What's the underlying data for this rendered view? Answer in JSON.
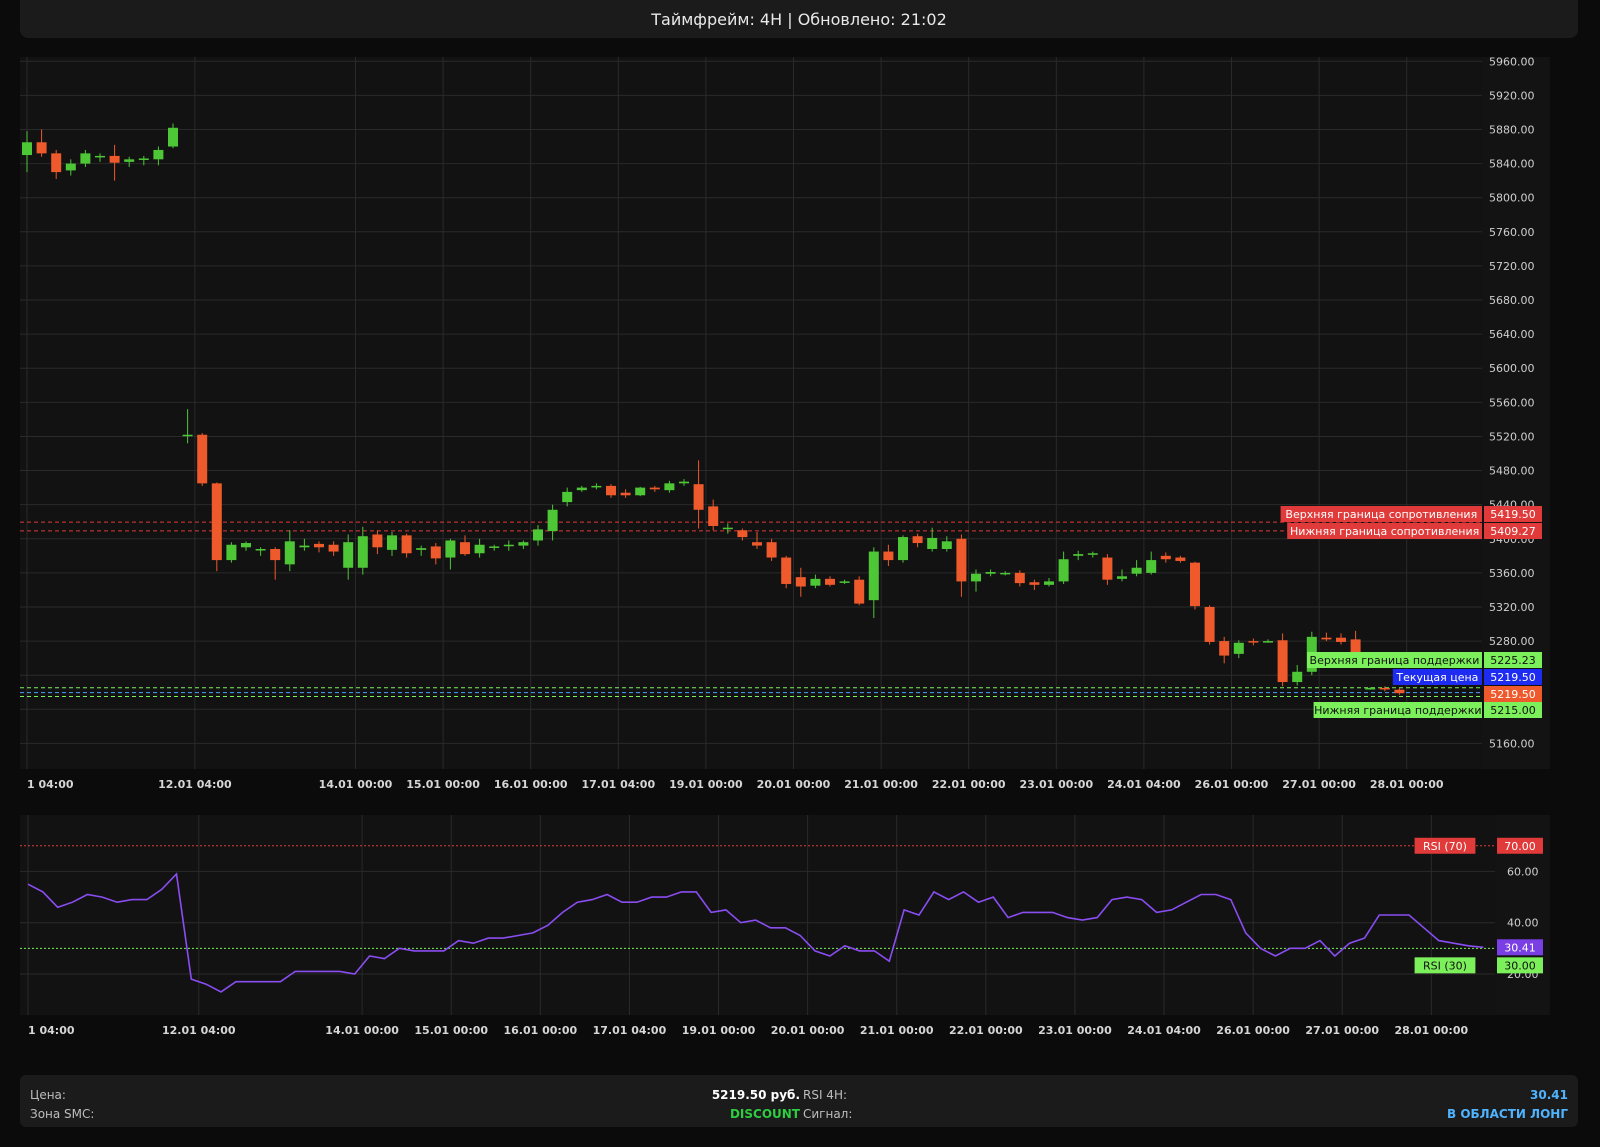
{
  "header": {
    "subtitle": "Таймфрейм: 4H | Обновлено: 21:02"
  },
  "colors": {
    "up": "#4ec737",
    "down": "#ee5a2b",
    "resistance": "#e03a3a",
    "support": "#7cf05a",
    "current": "#1d2cf0",
    "rsi_line": "#8a4df2",
    "rsi_badge": "#7a3fe4",
    "grid": "#2a2a2a"
  },
  "chart_data": [
    {
      "type": "candlestick",
      "yaxis": {
        "ticks": [
          "5960.00",
          "5920.00",
          "5880.00",
          "5840.00",
          "5800.00",
          "5760.00",
          "5720.00",
          "5680.00",
          "5640.00",
          "5600.00",
          "5560.00",
          "5520.00",
          "5480.00",
          "5440.00",
          "5400.00",
          "5360.00",
          "5320.00",
          "5280.00",
          "5240.00",
          "5200.00",
          "5160.00"
        ],
        "range": [
          5130,
          5965
        ]
      },
      "xaxis": {
        "ticks": [
          "1 04:00",
          "12.01 04:00",
          "14.01 00:00",
          "15.01 00:00",
          "16.01 00:00",
          "17.01 04:00",
          "19.01 00:00",
          "20.01 00:00",
          "21.01 00:00",
          "22.01 00:00",
          "23.01 00:00",
          "24.01 04:00",
          "26.01 00:00",
          "27.01 00:00",
          "28.01 00:00"
        ],
        "tick_index": [
          0,
          11.5,
          22.5,
          28.5,
          34.5,
          40.5,
          46.5,
          52.5,
          58.5,
          64.5,
          70.5,
          76.5,
          82.5,
          88.5,
          94.5
        ]
      },
      "candles": [
        [
          5850,
          5865,
          5878,
          5830
        ],
        [
          5865,
          5852,
          5880,
          5848
        ],
        [
          5852,
          5830,
          5856,
          5822
        ],
        [
          5832,
          5840,
          5845,
          5826
        ],
        [
          5840,
          5852,
          5856,
          5836
        ],
        [
          5848,
          5849,
          5852,
          5842
        ],
        [
          5849,
          5841,
          5862,
          5820
        ],
        [
          5842,
          5845,
          5848,
          5836
        ],
        [
          5846,
          5846,
          5849,
          5838
        ],
        [
          5845,
          5856,
          5860,
          5838
        ],
        [
          5860,
          5882,
          5887,
          5858
        ],
        [
          5522,
          5522,
          5552,
          5512
        ],
        [
          5522,
          5465,
          5524,
          5462
        ],
        [
          5465,
          5375,
          5466,
          5362
        ],
        [
          5375,
          5393,
          5396,
          5372
        ],
        [
          5390,
          5395,
          5397,
          5386
        ],
        [
          5387,
          5388,
          5390,
          5380
        ],
        [
          5388,
          5375,
          5390,
          5352
        ],
        [
          5370,
          5397,
          5410,
          5362
        ],
        [
          5390,
          5392,
          5400,
          5386
        ],
        [
          5394,
          5390,
          5397,
          5384
        ],
        [
          5393,
          5385,
          5397,
          5380
        ],
        [
          5366,
          5396,
          5405,
          5352
        ],
        [
          5366,
          5403,
          5414,
          5358
        ],
        [
          5405,
          5390,
          5410,
          5382
        ],
        [
          5387,
          5404,
          5408,
          5380
        ],
        [
          5404,
          5383,
          5406,
          5378
        ],
        [
          5387,
          5389,
          5392,
          5380
        ],
        [
          5391,
          5377,
          5395,
          5370
        ],
        [
          5378,
          5398,
          5400,
          5364
        ],
        [
          5396,
          5382,
          5404,
          5380
        ],
        [
          5383,
          5393,
          5400,
          5378
        ],
        [
          5390,
          5391,
          5393,
          5386
        ],
        [
          5393,
          5393,
          5398,
          5386
        ],
        [
          5392,
          5396,
          5398,
          5388
        ],
        [
          5398,
          5411,
          5416,
          5392
        ],
        [
          5409,
          5434,
          5440,
          5398
        ],
        [
          5443,
          5455,
          5460,
          5438
        ],
        [
          5457,
          5460,
          5462,
          5455
        ],
        [
          5462,
          5462,
          5465,
          5458
        ],
        [
          5462,
          5451,
          5464,
          5448
        ],
        [
          5454,
          5451,
          5458,
          5448
        ],
        [
          5451,
          5460,
          5461,
          5450
        ],
        [
          5460,
          5458,
          5462,
          5455
        ],
        [
          5457,
          5465,
          5468,
          5454
        ],
        [
          5465,
          5467,
          5470,
          5462
        ],
        [
          5464,
          5434,
          5492,
          5412
        ],
        [
          5438,
          5415,
          5446,
          5410
        ],
        [
          5412,
          5413,
          5418,
          5406
        ],
        [
          5410,
          5402,
          5412,
          5398
        ],
        [
          5396,
          5392,
          5408,
          5388
        ],
        [
          5396,
          5378,
          5400,
          5374
        ],
        [
          5378,
          5347,
          5380,
          5342
        ],
        [
          5355,
          5344,
          5366,
          5332
        ],
        [
          5345,
          5353,
          5358,
          5342
        ],
        [
          5353,
          5346,
          5356,
          5344
        ],
        [
          5350,
          5350,
          5352,
          5347
        ],
        [
          5352,
          5324,
          5356,
          5322
        ],
        [
          5328,
          5385,
          5390,
          5307
        ],
        [
          5385,
          5375,
          5393,
          5368
        ],
        [
          5375,
          5402,
          5404,
          5372
        ],
        [
          5403,
          5395,
          5406,
          5390
        ],
        [
          5388,
          5401,
          5413,
          5385
        ],
        [
          5388,
          5397,
          5403,
          5385
        ],
        [
          5400,
          5350,
          5405,
          5332
        ],
        [
          5350,
          5359,
          5364,
          5338
        ],
        [
          5359,
          5361,
          5364,
          5356
        ],
        [
          5360,
          5360,
          5362,
          5357
        ],
        [
          5360,
          5348,
          5363,
          5344
        ],
        [
          5349,
          5346,
          5352,
          5340
        ],
        [
          5346,
          5350,
          5354,
          5344
        ],
        [
          5350,
          5376,
          5385,
          5347
        ],
        [
          5380,
          5382,
          5386,
          5375
        ],
        [
          5382,
          5383,
          5385,
          5378
        ],
        [
          5378,
          5352,
          5382,
          5346
        ],
        [
          5353,
          5356,
          5364,
          5350
        ],
        [
          5359,
          5366,
          5375,
          5356
        ],
        [
          5360,
          5375,
          5385,
          5358
        ],
        [
          5380,
          5376,
          5384,
          5372
        ],
        [
          5378,
          5374,
          5380,
          5372
        ],
        [
          5372,
          5321,
          5373,
          5317
        ],
        [
          5320,
          5279,
          5322,
          5276
        ],
        [
          5280,
          5263,
          5285,
          5254
        ],
        [
          5265,
          5278,
          5281,
          5260
        ],
        [
          5280,
          5279,
          5283,
          5275
        ],
        [
          5280,
          5280,
          5282,
          5278
        ],
        [
          5281,
          5232,
          5289,
          5227
        ],
        [
          5232,
          5244,
          5252,
          5228
        ],
        [
          5244,
          5285,
          5291,
          5240
        ],
        [
          5284,
          5282,
          5290,
          5280
        ],
        [
          5284,
          5279,
          5289,
          5276
        ],
        [
          5282,
          5266,
          5292,
          5262
        ],
        [
          5225,
          5225,
          5226,
          5223
        ],
        [
          5225,
          5224,
          5227,
          5221
        ],
        [
          5223,
          5219,
          5225,
          5217
        ]
      ],
      "levels": [
        {
          "name": "Верхняя граница сопротивления",
          "value": 5419.5,
          "value_label": "5419.50",
          "kind": "resistance"
        },
        {
          "name": "Нижняя граница сопротивления",
          "value": 5409.27,
          "value_label": "5409.27",
          "kind": "resistance"
        },
        {
          "name": "Верхняя граница поддержки",
          "value": 5225.23,
          "value_label": "5225.23",
          "kind": "support"
        },
        {
          "name": "Текущая цена",
          "value": 5219.5,
          "value_label": "5219.50",
          "kind": "current"
        },
        {
          "name": "Нижняя граница поддержки",
          "value": 5215.0,
          "value_label": "5215.00",
          "kind": "support"
        }
      ],
      "last_price_label": "5219.50"
    },
    {
      "type": "line",
      "yaxis": {
        "ticks": [
          "60.00",
          "40.00",
          "20.00"
        ],
        "range": [
          4,
          82
        ]
      },
      "xaxis": {
        "ticks": [
          "1 04:00",
          "12.01 04:00",
          "14.01 00:00",
          "15.01 00:00",
          "16.01 00:00",
          "17.01 04:00",
          "19.01 00:00",
          "20.01 00:00",
          "21.01 00:00",
          "22.01 00:00",
          "23.01 00:00",
          "24.01 04:00",
          "26.01 00:00",
          "27.01 00:00",
          "28.01 00:00"
        ],
        "tick_index": [
          0,
          11.5,
          22.5,
          28.5,
          34.5,
          40.5,
          46.5,
          52.5,
          58.5,
          64.5,
          70.5,
          76.5,
          82.5,
          88.5,
          94.5
        ]
      },
      "series": [
        {
          "values": [
            55,
            52,
            46,
            48,
            51,
            50,
            48,
            49,
            49,
            53,
            59,
            18,
            16,
            13,
            17,
            17,
            17,
            17,
            21,
            21,
            21,
            21,
            20,
            27,
            26,
            30,
            29,
            29,
            29,
            33,
            32,
            34,
            34,
            35,
            36,
            39,
            44,
            48,
            49,
            51,
            48,
            48,
            50,
            50,
            52,
            52,
            44,
            45,
            40,
            41,
            38,
            38,
            35,
            29,
            27,
            31,
            29,
            29,
            25,
            45,
            43,
            52,
            49,
            52,
            48,
            50,
            42,
            44,
            44,
            44,
            42,
            41,
            42,
            49,
            50,
            49,
            44,
            45,
            48,
            51,
            51,
            49,
            36,
            30,
            27,
            30,
            30,
            33,
            27,
            32,
            34,
            43,
            43,
            43,
            38,
            33,
            32,
            31,
            30.41
          ]
        },
        {
          "name": "RSI (70)",
          "level": 70,
          "value_label": "70.00"
        },
        {
          "name": "RSI (30)",
          "level": 30,
          "value_label": "30.00"
        }
      ],
      "last_value_label": "30.41"
    }
  ],
  "footer": {
    "price_label": "Цена:",
    "price_value": "5219.50 руб.",
    "zone_label": "Зона SMC:",
    "zone_value": "DISCOUNT",
    "rsi_label": "RSI 4H:",
    "rsi_value": "30.41",
    "signal_label": "Сигнал:",
    "signal_value": "В ОБЛАСТИ ЛОНГ"
  }
}
